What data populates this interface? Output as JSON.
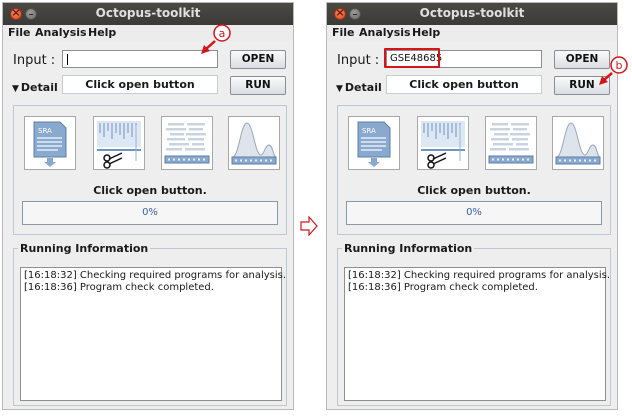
{
  "windows": [
    {
      "title": "Octopus-toolkit",
      "menu": [
        "File",
        "Analysis",
        "Help"
      ],
      "input_label": "Input :",
      "input_value": "",
      "open_button": "OPEN",
      "run_button": "RUN",
      "detail_label": "Detail",
      "status_box": "Click open button",
      "panel_status": "Click open button.",
      "progress": {
        "percent": 0,
        "label": "0%"
      },
      "sra_label": "SRA",
      "running_title": "Running Information",
      "log": [
        "[16:18:32] Checking required programs for analysis.",
        "[16:18:36] Program check completed."
      ],
      "annotation": "a"
    },
    {
      "title": "Octopus-toolkit",
      "menu": [
        "File",
        "Analysis",
        "Help"
      ],
      "input_label": "Input :",
      "input_value": "GSE48685",
      "open_button": "OPEN",
      "run_button": "RUN",
      "detail_label": "Detail",
      "status_box": "Click open button",
      "panel_status": "Click open button.",
      "progress": {
        "percent": 0,
        "label": "0%"
      },
      "sra_label": "SRA",
      "running_title": "Running Information",
      "log": [
        "[16:18:32] Checking required programs for analysis.",
        "[16:18:36] Program check completed."
      ],
      "annotation": "b"
    }
  ],
  "colors": {
    "annotation_red": "#d4161b",
    "highlight_red": "#d4161b",
    "progress_text": "#3b5fa5",
    "icon_blue": "#6f95c2"
  },
  "icons": [
    "sra-file-icon",
    "trimming-icon",
    "alignment-icon",
    "peak-calling-icon",
    "arrow-right-icon"
  ]
}
